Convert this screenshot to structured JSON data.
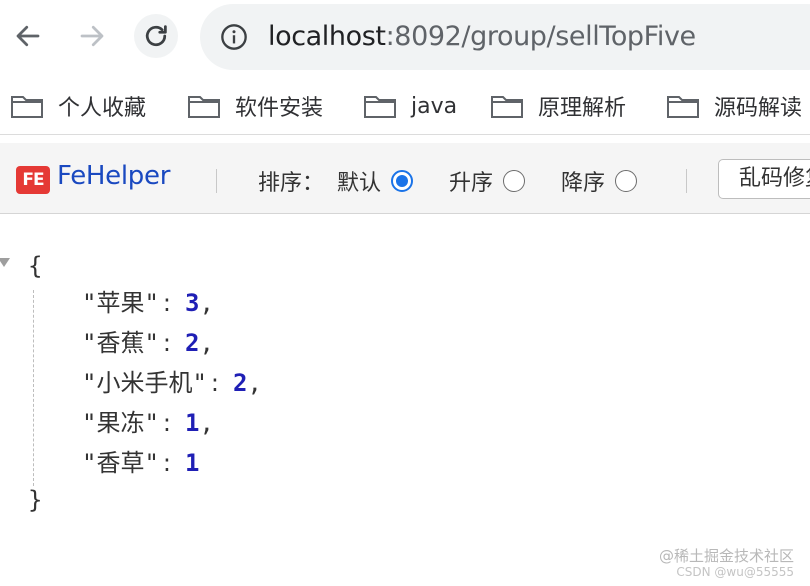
{
  "browser": {
    "url_host": "localhost",
    "url_rest": ":8092/group/sellTopFive"
  },
  "bookmarks": [
    {
      "label": "个人收藏"
    },
    {
      "label": "软件安装"
    },
    {
      "label": "java"
    },
    {
      "label": "原理解析"
    },
    {
      "label": "源码解读"
    }
  ],
  "fehelper": {
    "logo_text": "FE",
    "name": "FeHelper",
    "sort_label": "排序：",
    "options": [
      {
        "label": "默认",
        "checked": true
      },
      {
        "label": "升序",
        "checked": false
      },
      {
        "label": "降序",
        "checked": false
      }
    ],
    "fix_button": "乱码修复"
  },
  "json_view": {
    "open_brace": "{",
    "close_brace": "}",
    "entries": [
      {
        "key": "苹果",
        "value": "3",
        "comma": ","
      },
      {
        "key": "香蕉",
        "value": "2",
        "comma": ","
      },
      {
        "key": "小米手机",
        "value": "2",
        "comma": ","
      },
      {
        "key": "果冻",
        "value": "1",
        "comma": ","
      },
      {
        "key": "香草",
        "value": "1",
        "comma": ""
      }
    ]
  },
  "watermark": {
    "line1": "@稀土掘金技术社区",
    "line2": "CSDN @wu@55555"
  },
  "colors": {
    "accent": "#1a73e8",
    "fehelper_brand": "#1a49c0",
    "json_number": "#1f1fb5",
    "fe_logo": "#e53935"
  }
}
